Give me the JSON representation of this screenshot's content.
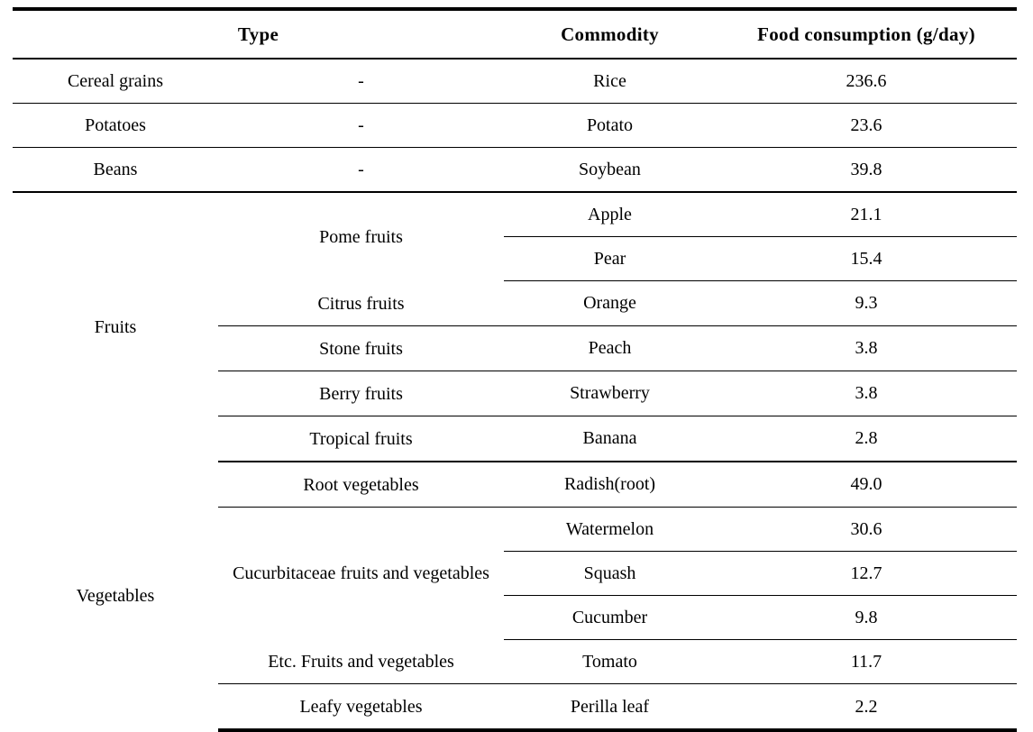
{
  "table": {
    "headers": {
      "type": "Type",
      "commodity": "Commodity",
      "consumption": "Food consumption (g/day)"
    },
    "rows": [
      {
        "group": "Cereal grains",
        "subtype": "-",
        "commodity": "Rice",
        "consumption": "236.6"
      },
      {
        "group": "Potatoes",
        "subtype": "-",
        "commodity": "Potato",
        "consumption": "23.6"
      },
      {
        "group": "Beans",
        "subtype": "-",
        "commodity": "Soybean",
        "consumption": "39.8"
      },
      {
        "group": "Fruits",
        "subtype": "Pome fruits",
        "commodity": "Apple",
        "consumption": "21.1"
      },
      {
        "group": "Fruits",
        "subtype": "Pome fruits",
        "commodity": "Pear",
        "consumption": "15.4"
      },
      {
        "group": "Fruits",
        "subtype": "Citrus fruits",
        "commodity": "Orange",
        "consumption": "9.3"
      },
      {
        "group": "Fruits",
        "subtype": "Stone fruits",
        "commodity": "Peach",
        "consumption": "3.8"
      },
      {
        "group": "Fruits",
        "subtype": "Berry fruits",
        "commodity": "Strawberry",
        "consumption": "3.8"
      },
      {
        "group": "Fruits",
        "subtype": "Tropical fruits",
        "commodity": "Banana",
        "consumption": "2.8"
      },
      {
        "group": "Vegetables",
        "subtype": "Root vegetables",
        "commodity": "Radish(root)",
        "consumption": "49.0"
      },
      {
        "group": "Vegetables",
        "subtype": "Cucurbitaceae fruits and vegetables",
        "commodity": "Watermelon",
        "consumption": "30.6"
      },
      {
        "group": "Vegetables",
        "subtype": "Cucurbitaceae fruits and vegetables",
        "commodity": "Squash",
        "consumption": "12.7"
      },
      {
        "group": "Vegetables",
        "subtype": "Cucurbitaceae fruits and vegetables",
        "commodity": "Cucumber",
        "consumption": "9.8"
      },
      {
        "group": "Vegetables",
        "subtype": "Etc. Fruits and vegetables",
        "commodity": "Tomato",
        "consumption": "11.7"
      },
      {
        "group": "Vegetables",
        "subtype": "Leafy vegetables",
        "commodity": "Perilla leaf",
        "consumption": "2.2"
      }
    ],
    "group_labels": {
      "fruits": "Fruits",
      "vegetables": "Vegetables"
    },
    "subtype_labels": {
      "pome": "Pome fruits",
      "citrus": "Citrus fruits",
      "stone": "Stone fruits",
      "berry": "Berry fruits",
      "tropical": "Tropical fruits",
      "root": "Root vegetables",
      "cucurbitaceae": "Cucurbitaceae fruits and vegetables",
      "etc": "Etc. Fruits and vegetables",
      "leafy": "Leafy vegetables"
    }
  }
}
